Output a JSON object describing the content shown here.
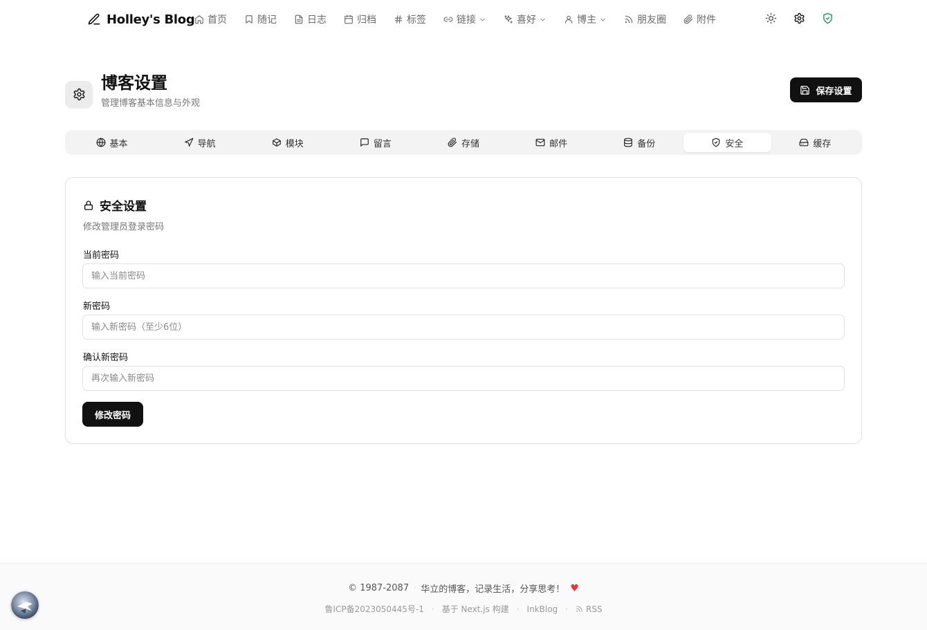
{
  "header": {
    "brand": "Holley's Blog",
    "nav": [
      {
        "label": "首页",
        "icon": "home-icon"
      },
      {
        "label": "随记",
        "icon": "bookmark-icon"
      },
      {
        "label": "日志",
        "icon": "file-text-icon"
      },
      {
        "label": "归档",
        "icon": "calendar-icon"
      },
      {
        "label": "标签",
        "icon": "hash-icon"
      },
      {
        "label": "链接",
        "icon": "link-icon",
        "dropdown": true
      },
      {
        "label": "喜好",
        "icon": "sparkles-icon",
        "dropdown": true
      },
      {
        "label": "博主",
        "icon": "user-icon",
        "dropdown": true
      },
      {
        "label": "朋友圈",
        "icon": "rss-icon"
      },
      {
        "label": "附件",
        "icon": "paperclip-icon"
      }
    ],
    "shield_color": "#16a34a"
  },
  "page": {
    "title": "博客设置",
    "subtitle": "管理博客基本信息与外观",
    "save_label": "保存设置"
  },
  "tabs": [
    {
      "label": "基本",
      "icon": "globe-icon"
    },
    {
      "label": "导航",
      "icon": "navigation-icon"
    },
    {
      "label": "模块",
      "icon": "box-icon"
    },
    {
      "label": "留言",
      "icon": "message-icon"
    },
    {
      "label": "存储",
      "icon": "paperclip-icon"
    },
    {
      "label": "邮件",
      "icon": "mail-icon"
    },
    {
      "label": "备份",
      "icon": "database-icon"
    },
    {
      "label": "安全",
      "icon": "shield-icon",
      "active": true
    },
    {
      "label": "缓存",
      "icon": "hard-drive-icon"
    }
  ],
  "security": {
    "title": "安全设置",
    "description": "修改管理员登录密码",
    "current_label": "当前密码",
    "current_placeholder": "输入当前密码",
    "new_label": "新密码",
    "new_placeholder": "输入新密码（至少6位）",
    "confirm_label": "确认新密码",
    "confirm_placeholder": "再次输入新密码",
    "submit_label": "修改密码"
  },
  "footer": {
    "copyright": "© 1987-2087",
    "slogan": "华立的博客，记录生活，分享思考！",
    "heart": "♥",
    "icp": "鲁ICP备2023050445号-1",
    "built_with": "基于 Next.js 构建",
    "theme": "InkBlog",
    "rss": "RSS",
    "heart_color": "#e53935"
  }
}
